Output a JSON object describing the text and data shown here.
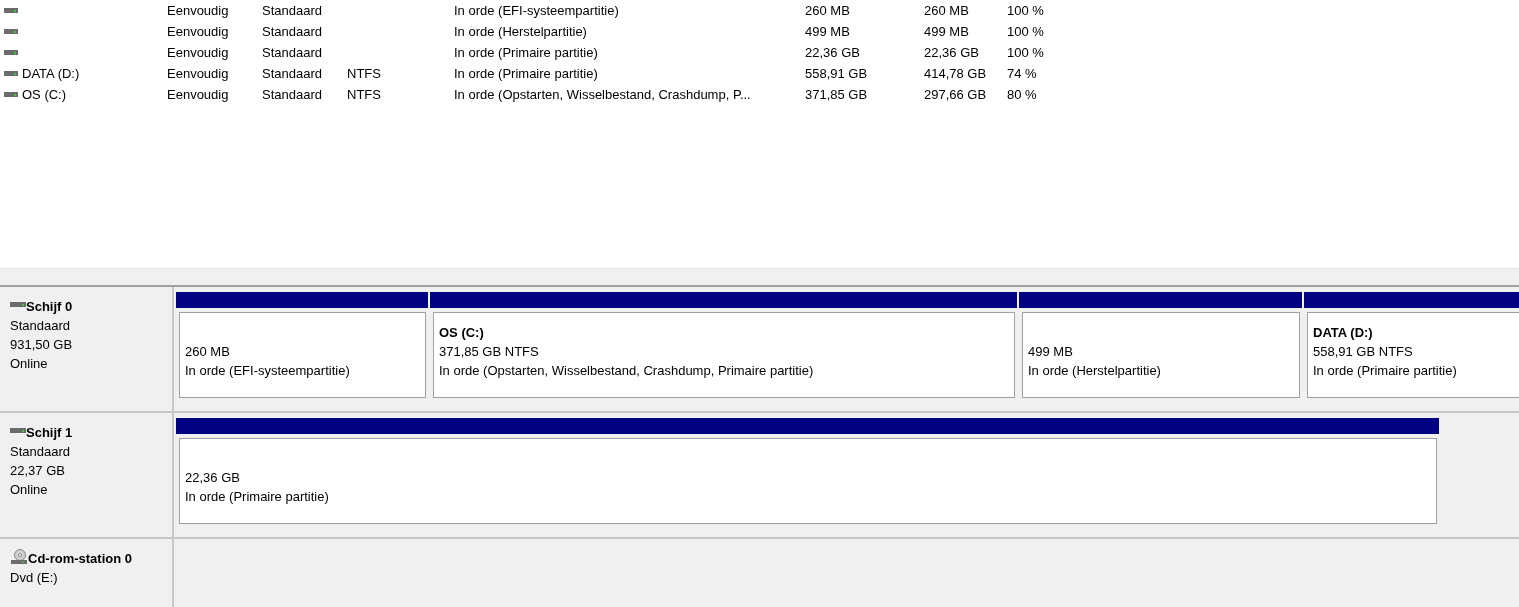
{
  "volumes": [
    {
      "layout": "Eenvoudig",
      "type": "Standaard",
      "status": "In orde (EFI-systeempartitie)",
      "capacity": "260 MB",
      "free": "260 MB",
      "percent_free": "100 %"
    },
    {
      "layout": "Eenvoudig",
      "type": "Standaard",
      "status": "In orde (Herstelpartitie)",
      "capacity": "499 MB",
      "free": "499 MB",
      "percent_free": "100 %"
    },
    {
      "layout": "Eenvoudig",
      "type": "Standaard",
      "status": "In orde (Primaire partitie)",
      "capacity": "22,36 GB",
      "free": "22,36 GB",
      "percent_free": "100 %"
    },
    {
      "name": "DATA (D:)",
      "layout": "Eenvoudig",
      "type": "Standaard",
      "filesystem": "NTFS",
      "status": "In orde (Primaire partitie)",
      "capacity": "558,91 GB",
      "free": "414,78 GB",
      "percent_free": "74 %"
    },
    {
      "name": "OS (C:)",
      "layout": "Eenvoudig",
      "type": "Standaard",
      "filesystem": "NTFS",
      "status": "In orde (Opstarten, Wisselbestand, Crashdump, P...",
      "capacity": "371,85 GB",
      "free": "297,66 GB",
      "percent_free": "80 %"
    }
  ],
  "disks": [
    {
      "kind": "disk",
      "name": "Schijf 0",
      "type": "Standaard",
      "size": "931,50 GB",
      "state": "Online",
      "partitions": [
        {
          "size": "260 MB",
          "status": "In orde (EFI-systeempartitie)"
        },
        {
          "title": "OS  (C:)",
          "size": "371,85 GB NTFS",
          "status": "In orde (Opstarten, Wisselbestand, Crashdump, Primaire partitie)"
        },
        {
          "size": "499 MB",
          "status": "In orde (Herstelpartitie)"
        },
        {
          "title": "DATA  (D:)",
          "size": "558,91 GB NTFS",
          "status": "In orde (Primaire partitie)"
        }
      ]
    },
    {
      "kind": "disk",
      "name": "Schijf 1",
      "type": "Standaard",
      "size": "22,37 GB",
      "state": "Online",
      "partitions": [
        {
          "size": "22,36 GB",
          "status": "In orde (Primaire partitie)"
        }
      ]
    },
    {
      "kind": "cdrom",
      "name": "Cd-rom-station 0",
      "type": "Dvd (E:)"
    }
  ]
}
